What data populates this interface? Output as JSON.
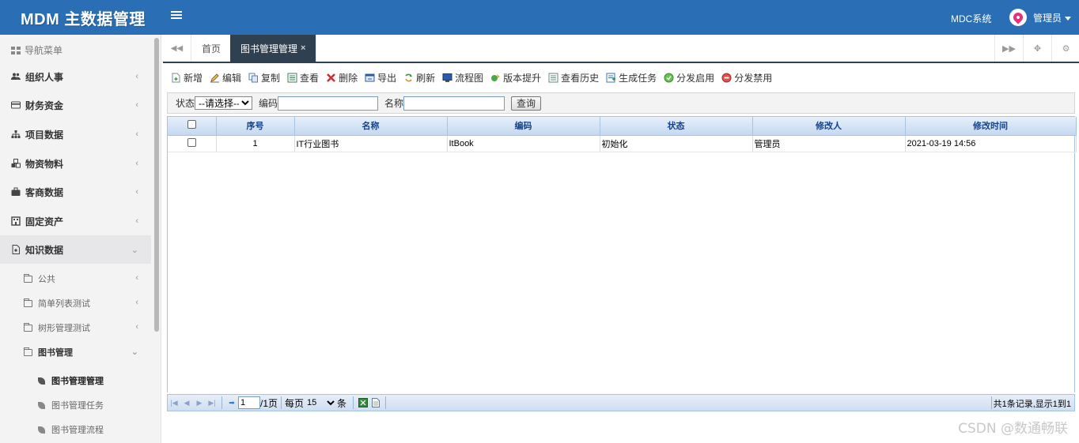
{
  "header": {
    "logo": "MDM 主数据管理",
    "system_link": "MDC系统",
    "user_name": "管理员",
    "brand_color": "#2a6fb5"
  },
  "sidebar": {
    "nav_title": "导航菜单",
    "items": [
      {
        "label": "组织人事",
        "icon": "users-icon"
      },
      {
        "label": "财务资金",
        "icon": "card-icon"
      },
      {
        "label": "项目数据",
        "icon": "sitemap-icon"
      },
      {
        "label": "物资物料",
        "icon": "cubes-icon"
      },
      {
        "label": "客商数据",
        "icon": "briefcase-icon"
      },
      {
        "label": "固定资产",
        "icon": "building-icon"
      },
      {
        "label": "知识数据",
        "icon": "file-icon"
      }
    ],
    "sub_items": [
      {
        "label": "公共"
      },
      {
        "label": "简单列表测试"
      },
      {
        "label": "树形管理测试"
      },
      {
        "label": "图书管理"
      }
    ],
    "leaf_items": [
      {
        "label": "图书管理管理"
      },
      {
        "label": "图书管理任务"
      },
      {
        "label": "图书管理流程"
      }
    ]
  },
  "tabs": [
    {
      "label": "首页"
    },
    {
      "label": "图书管理管理",
      "close": "×"
    }
  ],
  "toolbar": [
    {
      "label": "新增",
      "icon": "add-icon"
    },
    {
      "label": "编辑",
      "icon": "edit-icon"
    },
    {
      "label": "复制",
      "icon": "copy-icon"
    },
    {
      "label": "查看",
      "icon": "view-icon"
    },
    {
      "label": "删除",
      "icon": "delete-icon"
    },
    {
      "label": "导出",
      "icon": "export-icon"
    },
    {
      "label": "刷新",
      "icon": "refresh-icon"
    },
    {
      "label": "流程图",
      "icon": "flowchart-icon"
    },
    {
      "label": "版本提升",
      "icon": "upgrade-icon"
    },
    {
      "label": "查看历史",
      "icon": "history-icon"
    },
    {
      "label": "生成任务",
      "icon": "task-icon"
    },
    {
      "label": "分发启用",
      "icon": "enable-icon"
    },
    {
      "label": "分发禁用",
      "icon": "disable-icon"
    }
  ],
  "search": {
    "status_label": "状态",
    "status_value": "--请选择--",
    "code_label": "编码",
    "code_value": "",
    "name_label": "名称",
    "name_value": "",
    "query_button": "查询"
  },
  "grid": {
    "columns": [
      "序号",
      "名称",
      "编码",
      "状态",
      "修改人",
      "修改时间"
    ],
    "rows": [
      [
        "1",
        "IT行业图书",
        "ItBook",
        "初始化",
        "管理员",
        "2021-03-19 14:56"
      ]
    ]
  },
  "pager": {
    "current_page": "1",
    "total_pages_label": "/1页",
    "per_page_label": "每页",
    "per_page_value": "15",
    "per_page_unit": "条",
    "info": "共1条记录,显示1到1"
  },
  "watermark": "CSDN @数通畅联"
}
